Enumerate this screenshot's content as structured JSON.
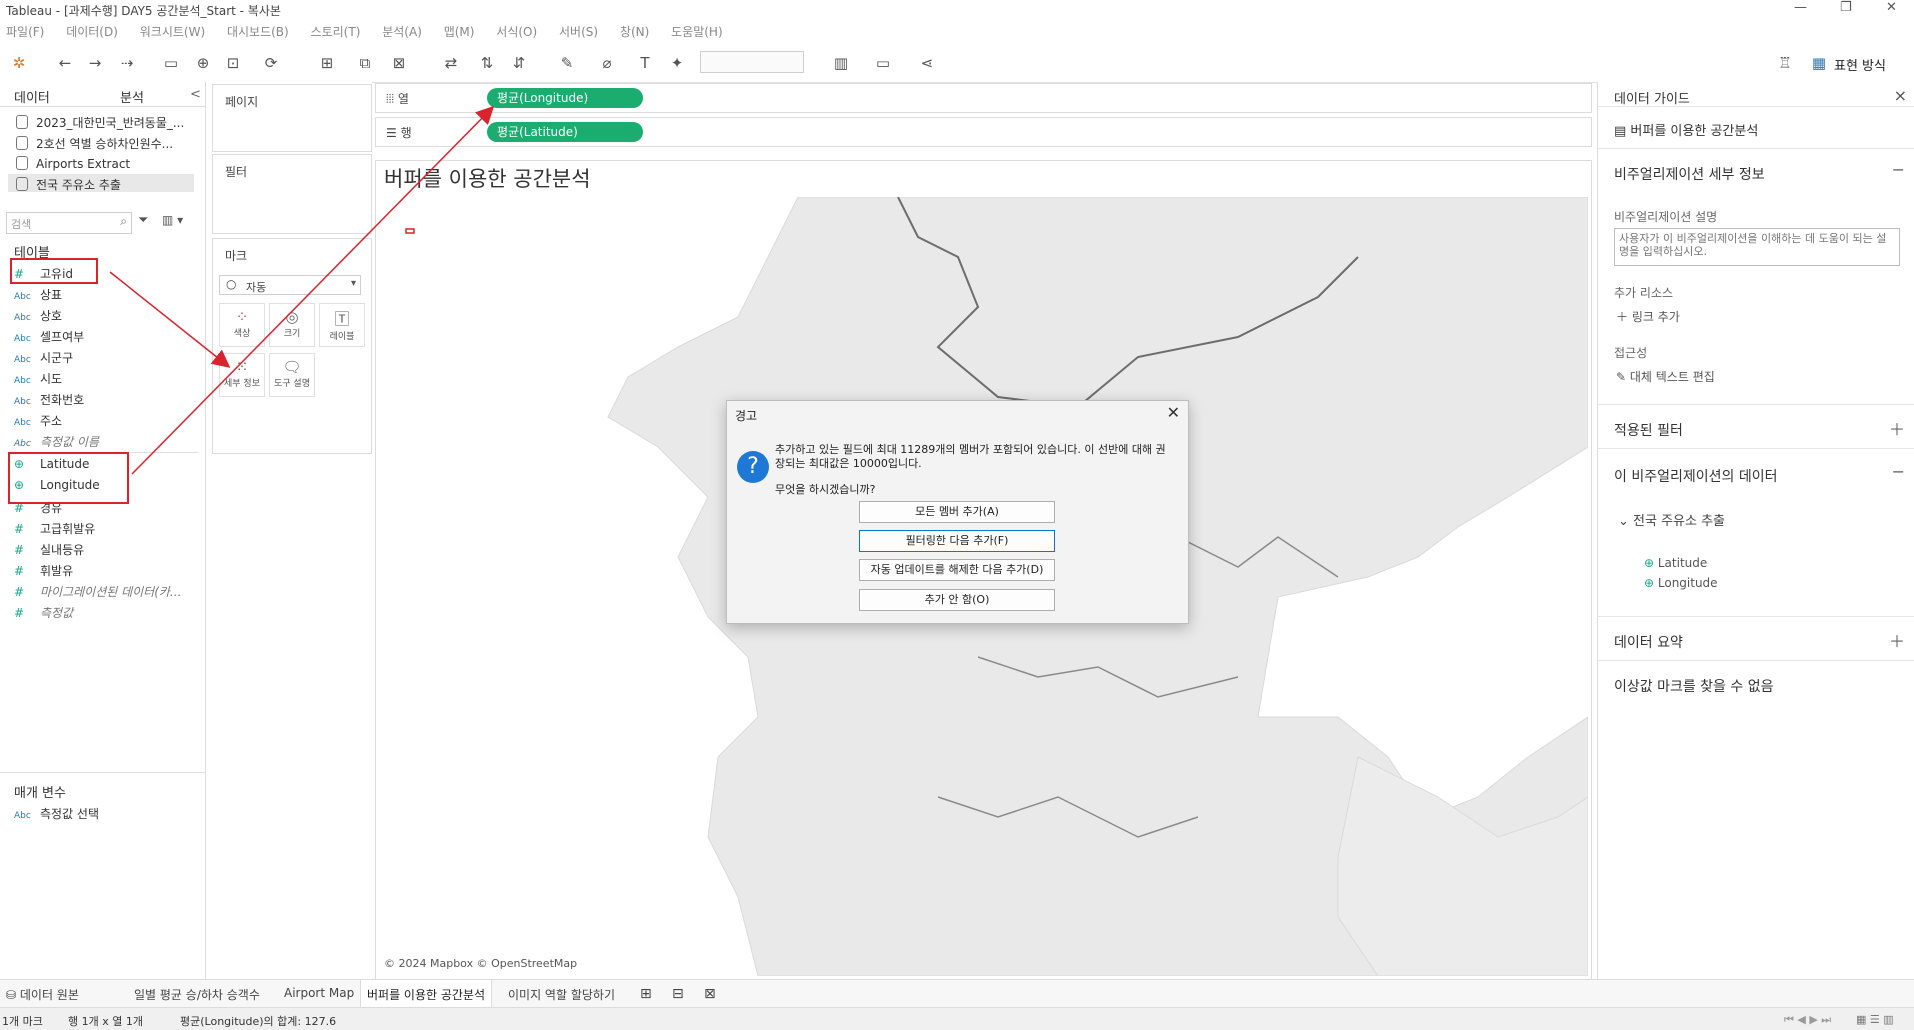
{
  "window": {
    "title": "Tableau - [과제수행] DAY5 공간분석_Start - 복사본",
    "controls": [
      "—",
      "❐",
      "✕"
    ]
  },
  "menu": [
    "파일(F)",
    "데이터(D)",
    "워크시트(W)",
    "대시보드(B)",
    "스토리(T)",
    "분석(A)",
    "맵(M)",
    "서식(O)",
    "서버(S)",
    "창(N)",
    "도움말(H)"
  ],
  "toolbar": {
    "show_me_label": "표현 방식"
  },
  "data_panel": {
    "tab_data": "데이터",
    "tab_analysis": "분석",
    "collapse": "<",
    "datasources": [
      "2023_대한민국_반려동물_...",
      "2호선 역별 승하차인원수...",
      "Airports Extract",
      "전국 주유소 추출"
    ],
    "search_placeholder": "검색",
    "tables_header": "테이블",
    "fields": [
      {
        "type": "#",
        "name": "고유id"
      },
      {
        "type": "Abc",
        "name": "상표"
      },
      {
        "type": "Abc",
        "name": "상호"
      },
      {
        "type": "Abc",
        "name": "셀프여부"
      },
      {
        "type": "Abc",
        "name": "시군구"
      },
      {
        "type": "Abc",
        "name": "시도"
      },
      {
        "type": "Abc",
        "name": "전화번호"
      },
      {
        "type": "Abc",
        "name": "주소"
      },
      {
        "type": "Abc",
        "name": "측정값 이름"
      },
      {
        "type": "⊕",
        "name": "Latitude"
      },
      {
        "type": "⊕",
        "name": "Longitude"
      },
      {
        "type": "#",
        "name": "경유"
      },
      {
        "type": "#",
        "name": "고급휘발유"
      },
      {
        "type": "#",
        "name": "실내등유"
      },
      {
        "type": "#",
        "name": "휘발유"
      },
      {
        "type": "#",
        "name": "마이그레이션된 데이터(카..."
      },
      {
        "type": "#",
        "name": "측정값"
      }
    ],
    "params_header": "매개 변수",
    "params": [
      {
        "type": "Abc",
        "name": "측정값 선택"
      }
    ]
  },
  "cards": {
    "pages": "페이지",
    "filters": "필터",
    "marks": "마크",
    "mark_type": "자동",
    "mark_buttons": [
      "색상",
      "크기",
      "레이블",
      "세부 정보",
      "도구 설명"
    ]
  },
  "shelves": {
    "columns_label": "열",
    "rows_label": "행",
    "columns_pill": "평균(Longitude)",
    "rows_pill": "평균(Latitude)"
  },
  "viz": {
    "title": "버퍼를 이용한 공간분석",
    "credit": "© 2024 Mapbox © OpenStreetMap"
  },
  "guide": {
    "header": "데이터 가이드",
    "close": "×",
    "sheet_name": "버퍼를 이용한 공간분석",
    "viz_details": "비주얼리제이션 세부 정보",
    "desc_label": "비주얼리제이션 설명",
    "desc_placeholder": "사용자가 이 비주얼리제이션을 이해하는 데 도움이 되는 설명을 입력하십시오.",
    "resources_label": "추가 리소스",
    "add_link": "링크 추가",
    "access_label": "접근성",
    "alt_text": "대체 텍스트 편집",
    "applied_filters": "적용된 필터",
    "viz_data": "이 비주얼리제이션의 데이터",
    "datasource": "전국 주유소 추출",
    "fields": [
      "Latitude",
      "Longitude"
    ],
    "data_summary": "데이터 요약",
    "outliers": "이상값 마크를 찾을 수 없음"
  },
  "dialog": {
    "title": "경고",
    "close": "✕",
    "message": "추가하고 있는 필드에 최대 11289개의 멤버가 포함되어 있습니다. 이 선반에 대해 권장되는 최대값은 10000입니다.",
    "question": "무엇을 하시겠습니까?",
    "buttons": [
      "모든 멤버 추가(A)",
      "필터링한 다음 추가(F)",
      "자동 업데이트를 해제한 다음 추가(D)",
      "추가 안 함(O)"
    ]
  },
  "sheet_tabs": [
    "데이터 원본",
    "일별 평균 승/하차 승객수",
    "Airport Map",
    "버퍼를 이용한 공간분석",
    "이미지 역할 할당하기"
  ],
  "status": {
    "marks": "1개 마크",
    "rows_cols": "행 1개 x 열 1개",
    "sum": "평균(Longitude)의 합계: 127.6"
  },
  "colors": {
    "pill": "#1aad6f",
    "annotation_red": "#d9232d",
    "dialog_icon": "#1e78d6"
  }
}
